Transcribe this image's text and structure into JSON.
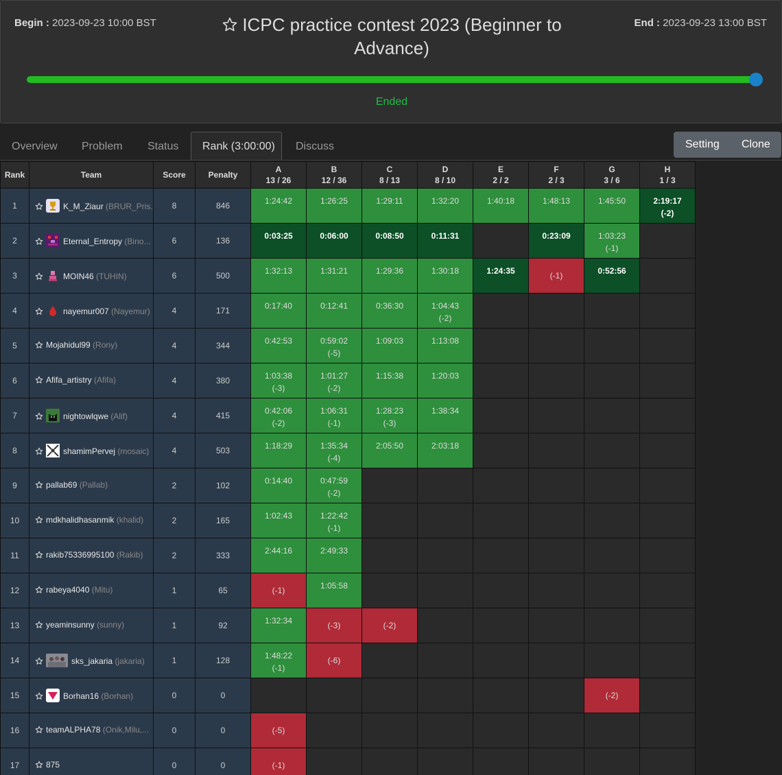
{
  "header": {
    "begin_label": "Begin :",
    "begin_time": "2023-09-23 10:00 BST",
    "end_label": "End :",
    "end_time": "2023-09-23 13:00 BST",
    "title": "ICPC practice contest 2023 (Beginner to Advance)",
    "status": "Ended",
    "progress": 1.0,
    "colors": {
      "progress": "#22bb22",
      "handle": "#1a82c8",
      "status": "#22bb44"
    }
  },
  "tabs": [
    {
      "label": "Overview"
    },
    {
      "label": "Problem"
    },
    {
      "label": "Status"
    },
    {
      "label": "Rank (3:00:00)"
    },
    {
      "label": "Discuss"
    }
  ],
  "buttons": {
    "setting": "Setting",
    "clone": "Clone"
  },
  "table": {
    "headers": {
      "rank": "Rank",
      "team": "Team",
      "score": "Score",
      "penalty": "Penalty"
    },
    "problems": [
      {
        "letter": "A",
        "stat": "13 / 26"
      },
      {
        "letter": "B",
        "stat": "12 / 36"
      },
      {
        "letter": "C",
        "stat": "8 / 13"
      },
      {
        "letter": "D",
        "stat": "8 / 10"
      },
      {
        "letter": "E",
        "stat": "2 / 2"
      },
      {
        "letter": "F",
        "stat": "2 / 3"
      },
      {
        "letter": "G",
        "stat": "3 / 6"
      },
      {
        "letter": "H",
        "stat": "1 / 3"
      }
    ],
    "colors": {
      "solved": "#2e8f3c",
      "first_solve": "#0d4f27",
      "failed": "#b02a37",
      "empty": "#2a2a2a",
      "team_bg": "#2b3a4a"
    },
    "rows": [
      {
        "rank": "1",
        "name": "K_M_Ziaur",
        "real": "(BRUR_Pris...",
        "avatar": "trophy",
        "score": "8",
        "penalty": "846",
        "cells": [
          [
            "s",
            "1:24:42",
            ""
          ],
          [
            "s",
            "1:26:25",
            ""
          ],
          [
            "s",
            "1:29:11",
            ""
          ],
          [
            "s",
            "1:32:20",
            ""
          ],
          [
            "s",
            "1:40:18",
            ""
          ],
          [
            "s",
            "1:48:13",
            ""
          ],
          [
            "s",
            "1:45:50",
            ""
          ],
          [
            "f1",
            "2:19:17",
            "(-2)"
          ]
        ]
      },
      {
        "rank": "2",
        "name": "Eternal_Entropy",
        "real": "(Bino...",
        "avatar": "pixel-purple",
        "score": "6",
        "penalty": "136",
        "cells": [
          [
            "f1",
            "0:03:25",
            ""
          ],
          [
            "f1",
            "0:06:00",
            ""
          ],
          [
            "f1",
            "0:08:50",
            ""
          ],
          [
            "f1",
            "0:11:31",
            ""
          ],
          [
            "e",
            "",
            ""
          ],
          [
            "f1",
            "0:23:09",
            ""
          ],
          [
            "s",
            "1:03:23",
            "(-1)"
          ],
          [
            "e",
            "",
            ""
          ]
        ]
      },
      {
        "rank": "3",
        "name": "MOIN46",
        "real": "(TUHIN)",
        "avatar": "pink-figure",
        "score": "6",
        "penalty": "500",
        "cells": [
          [
            "s",
            "1:32:13",
            ""
          ],
          [
            "s",
            "1:31:21",
            ""
          ],
          [
            "s",
            "1:29:36",
            ""
          ],
          [
            "s",
            "1:30:18",
            ""
          ],
          [
            "f1",
            "1:24:35",
            ""
          ],
          [
            "x",
            "(-1)",
            ""
          ],
          [
            "f1",
            "0:52:56",
            ""
          ],
          [
            "e",
            "",
            ""
          ]
        ]
      },
      {
        "rank": "4",
        "name": "nayemur007",
        "real": "(Nayemur)",
        "avatar": "red-drop",
        "score": "4",
        "penalty": "171",
        "cells": [
          [
            "s",
            "0:17:40",
            ""
          ],
          [
            "s",
            "0:12:41",
            ""
          ],
          [
            "s",
            "0:36:30",
            ""
          ],
          [
            "s",
            "1:04:43",
            "(-2)"
          ],
          [
            "e",
            "",
            ""
          ],
          [
            "e",
            "",
            ""
          ],
          [
            "e",
            "",
            ""
          ],
          [
            "e",
            "",
            ""
          ]
        ]
      },
      {
        "rank": "5",
        "name": "Mojahidul99",
        "real": "(Rony)",
        "avatar": "",
        "score": "4",
        "penalty": "344",
        "cells": [
          [
            "s",
            "0:42:53",
            ""
          ],
          [
            "s",
            "0:59:02",
            "(-5)"
          ],
          [
            "s",
            "1:09:03",
            ""
          ],
          [
            "s",
            "1:13:08",
            ""
          ],
          [
            "e",
            "",
            ""
          ],
          [
            "e",
            "",
            ""
          ],
          [
            "e",
            "",
            ""
          ],
          [
            "e",
            "",
            ""
          ]
        ]
      },
      {
        "rank": "6",
        "name": "Afifa_artistry",
        "real": "(Afifa)",
        "avatar": "",
        "score": "4",
        "penalty": "380",
        "cells": [
          [
            "s",
            "1:03:38",
            "(-3)"
          ],
          [
            "s",
            "1:01:27",
            "(-2)"
          ],
          [
            "s",
            "1:15:38",
            ""
          ],
          [
            "s",
            "1:20:03",
            ""
          ],
          [
            "e",
            "",
            ""
          ],
          [
            "e",
            "",
            ""
          ],
          [
            "e",
            "",
            ""
          ],
          [
            "e",
            "",
            ""
          ]
        ]
      },
      {
        "rank": "7",
        "name": "nightowlqwe",
        "real": "(Alif)",
        "avatar": "black-cat",
        "score": "4",
        "penalty": "415",
        "cells": [
          [
            "s",
            "0:42:06",
            "(-2)"
          ],
          [
            "s",
            "1:06:31",
            "(-1)"
          ],
          [
            "s",
            "1:28:23",
            "(-3)"
          ],
          [
            "s",
            "1:38:34",
            ""
          ],
          [
            "e",
            "",
            ""
          ],
          [
            "e",
            "",
            ""
          ],
          [
            "e",
            "",
            ""
          ],
          [
            "e",
            "",
            ""
          ]
        ]
      },
      {
        "rank": "8",
        "name": "shamimPervej",
        "real": "(mosaic)",
        "avatar": "white-pattern",
        "score": "4",
        "penalty": "503",
        "cells": [
          [
            "s",
            "1:18:29",
            ""
          ],
          [
            "s",
            "1:35:34",
            "(-4)"
          ],
          [
            "s",
            "2:05:50",
            ""
          ],
          [
            "s",
            "2:03:18",
            ""
          ],
          [
            "e",
            "",
            ""
          ],
          [
            "e",
            "",
            ""
          ],
          [
            "e",
            "",
            ""
          ],
          [
            "e",
            "",
            ""
          ]
        ]
      },
      {
        "rank": "9",
        "name": "pallab69",
        "real": "(Pallab)",
        "avatar": "",
        "score": "2",
        "penalty": "102",
        "cells": [
          [
            "s",
            "0:14:40",
            ""
          ],
          [
            "s",
            "0:47:59",
            "(-2)"
          ],
          [
            "e",
            "",
            ""
          ],
          [
            "e",
            "",
            ""
          ],
          [
            "e",
            "",
            ""
          ],
          [
            "e",
            "",
            ""
          ],
          [
            "e",
            "",
            ""
          ],
          [
            "e",
            "",
            ""
          ]
        ]
      },
      {
        "rank": "10",
        "name": "mdkhalidhasanmik",
        "real": "(khalid)",
        "avatar": "",
        "score": "2",
        "penalty": "165",
        "cells": [
          [
            "s",
            "1:02:43",
            ""
          ],
          [
            "s",
            "1:22:42",
            "(-1)"
          ],
          [
            "e",
            "",
            ""
          ],
          [
            "e",
            "",
            ""
          ],
          [
            "e",
            "",
            ""
          ],
          [
            "e",
            "",
            ""
          ],
          [
            "e",
            "",
            ""
          ],
          [
            "e",
            "",
            ""
          ]
        ]
      },
      {
        "rank": "11",
        "name": "rakib75336995100",
        "real": "(Rakib)",
        "avatar": "",
        "score": "2",
        "penalty": "333",
        "cells": [
          [
            "s",
            "2:44:16",
            ""
          ],
          [
            "s",
            "2:49:33",
            ""
          ],
          [
            "e",
            "",
            ""
          ],
          [
            "e",
            "",
            ""
          ],
          [
            "e",
            "",
            ""
          ],
          [
            "e",
            "",
            ""
          ],
          [
            "e",
            "",
            ""
          ],
          [
            "e",
            "",
            ""
          ]
        ]
      },
      {
        "rank": "12",
        "name": "rabeya4040",
        "real": "(Mitu)",
        "avatar": "",
        "score": "1",
        "penalty": "65",
        "cells": [
          [
            "x",
            "(-1)",
            ""
          ],
          [
            "s",
            "1:05:58",
            ""
          ],
          [
            "e",
            "",
            ""
          ],
          [
            "e",
            "",
            ""
          ],
          [
            "e",
            "",
            ""
          ],
          [
            "e",
            "",
            ""
          ],
          [
            "e",
            "",
            ""
          ],
          [
            "e",
            "",
            ""
          ]
        ]
      },
      {
        "rank": "13",
        "name": "yeaminsunny",
        "real": "(sunny)",
        "avatar": "",
        "score": "1",
        "penalty": "92",
        "cells": [
          [
            "s",
            "1:32:34",
            ""
          ],
          [
            "x",
            "(-3)",
            ""
          ],
          [
            "x",
            "(-2)",
            ""
          ],
          [
            "e",
            "",
            ""
          ],
          [
            "e",
            "",
            ""
          ],
          [
            "e",
            "",
            ""
          ],
          [
            "e",
            "",
            ""
          ],
          [
            "e",
            "",
            ""
          ]
        ]
      },
      {
        "rank": "14",
        "name": "sks_jakaria",
        "real": "(jakaria)",
        "avatar": "group-photo",
        "score": "1",
        "penalty": "128",
        "cells": [
          [
            "s",
            "1:48:22",
            "(-1)"
          ],
          [
            "x",
            "(-6)",
            ""
          ],
          [
            "e",
            "",
            ""
          ],
          [
            "e",
            "",
            ""
          ],
          [
            "e",
            "",
            ""
          ],
          [
            "e",
            "",
            ""
          ],
          [
            "e",
            "",
            ""
          ],
          [
            "e",
            "",
            ""
          ]
        ]
      },
      {
        "rank": "15",
        "name": "Borhan16",
        "real": "(Borhan)",
        "avatar": "pink-triangle",
        "score": "0",
        "penalty": "0",
        "cells": [
          [
            "e",
            "",
            ""
          ],
          [
            "e",
            "",
            ""
          ],
          [
            "e",
            "",
            ""
          ],
          [
            "e",
            "",
            ""
          ],
          [
            "e",
            "",
            ""
          ],
          [
            "e",
            "",
            ""
          ],
          [
            "x",
            "(-2)",
            ""
          ],
          [
            "e",
            "",
            ""
          ]
        ]
      },
      {
        "rank": "16",
        "name": "teamALPHA78",
        "real": "(Onik,Milu,...",
        "avatar": "",
        "score": "0",
        "penalty": "0",
        "cells": [
          [
            "x",
            "(-5)",
            ""
          ],
          [
            "e",
            "",
            ""
          ],
          [
            "e",
            "",
            ""
          ],
          [
            "e",
            "",
            ""
          ],
          [
            "e",
            "",
            ""
          ],
          [
            "e",
            "",
            ""
          ],
          [
            "e",
            "",
            ""
          ],
          [
            "e",
            "",
            ""
          ]
        ]
      },
      {
        "rank": "17",
        "name": "875",
        "real": "",
        "avatar": "",
        "score": "0",
        "penalty": "0",
        "cells": [
          [
            "x",
            "(-1)",
            ""
          ],
          [
            "e",
            "",
            ""
          ],
          [
            "e",
            "",
            ""
          ],
          [
            "e",
            "",
            ""
          ],
          [
            "e",
            "",
            ""
          ],
          [
            "e",
            "",
            ""
          ],
          [
            "e",
            "",
            ""
          ],
          [
            "e",
            "",
            ""
          ]
        ]
      }
    ]
  }
}
